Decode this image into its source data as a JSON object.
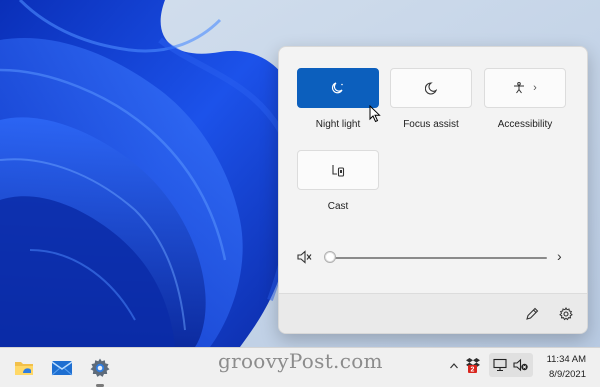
{
  "quick_settings": {
    "tiles": [
      {
        "label": "Night light",
        "icon": "night-light-icon",
        "active": true
      },
      {
        "label": "Focus assist",
        "icon": "moon-icon",
        "active": false
      },
      {
        "label": "Accessibility",
        "icon": "accessibility-icon",
        "active": false,
        "has_chevron": true
      },
      {
        "label": "Cast",
        "icon": "cast-icon",
        "active": false
      }
    ],
    "volume": {
      "level": 0,
      "icon": "speaker-muted-icon"
    },
    "footer": {
      "edit_icon": "pencil-icon",
      "settings_icon": "gear-icon"
    },
    "accent_color": "#0c5fbd"
  },
  "taskbar": {
    "apps": [
      {
        "name": "File Explorer",
        "icon": "file-explorer-icon"
      },
      {
        "name": "Mail",
        "icon": "mail-icon"
      },
      {
        "name": "Settings",
        "icon": "settings-icon"
      }
    ],
    "watermark": "groovyPost.com",
    "tray_icons": [
      "chevron-up-icon",
      "dropbox-icon",
      "network-icon",
      "speaker-muted-icon"
    ],
    "clock": {
      "time": "11:34 AM",
      "date": "8/9/2021"
    }
  },
  "colors": {
    "wallpaper_blue": "#1a3fd6",
    "wallpaper_bg": "#c7d6e9"
  }
}
